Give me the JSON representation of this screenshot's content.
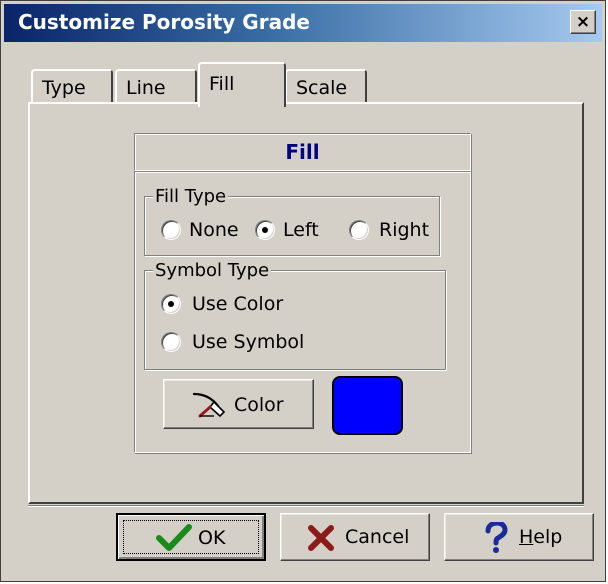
{
  "window": {
    "title": "Customize Porosity Grade",
    "close_glyph": "×"
  },
  "tabs": [
    {
      "label": "Type",
      "active": false
    },
    {
      "label": "Line",
      "active": false
    },
    {
      "label": "Fill",
      "active": true
    },
    {
      "label": "Scale",
      "active": false
    }
  ],
  "fill_panel": {
    "header": "Fill",
    "fill_type": {
      "legend": "Fill Type",
      "options": [
        {
          "label": "None",
          "selected": false
        },
        {
          "label": "Left",
          "selected": true
        },
        {
          "label": "Right",
          "selected": false
        }
      ]
    },
    "symbol_type": {
      "legend": "Symbol Type",
      "options": [
        {
          "label": "Use Color",
          "selected": true
        },
        {
          "label": "Use Symbol",
          "selected": false
        }
      ]
    },
    "color_button_label": "Color",
    "color_button_icon": "paint-brush-icon",
    "selected_color": "#0000ff"
  },
  "buttons": {
    "ok_label": "OK",
    "ok_icon": "checkmark-icon",
    "cancel_label": "Cancel",
    "cancel_icon": "x-mark-icon",
    "help_prefix": "",
    "help_underlined": "H",
    "help_rest": "elp",
    "help_icon": "question-mark-icon"
  },
  "colors": {
    "title_gradient_start": "#0a246a",
    "title_gradient_end": "#a6caf0",
    "dialog_face": "#d4d0c8",
    "header_text": "#000080",
    "ok_check": "#1a8a1a",
    "cancel_x": "#8b1a1a",
    "help_question": "#1a2a9a"
  }
}
